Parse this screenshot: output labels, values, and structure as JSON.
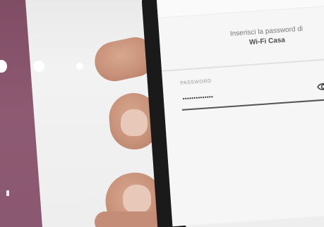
{
  "screen": {
    "prompt": "Inserisci la password di",
    "network_name": "Wi-Fi Casa"
  },
  "password_field": {
    "label": "PASSWORD",
    "value": "••••••••••••••"
  },
  "icons": {
    "visibility_toggle": "eye-icon"
  },
  "loading_dots": 4,
  "colors": {
    "banner": "#8a5870",
    "screen_background": "#f6f6f6",
    "field_underline": "#555555"
  }
}
